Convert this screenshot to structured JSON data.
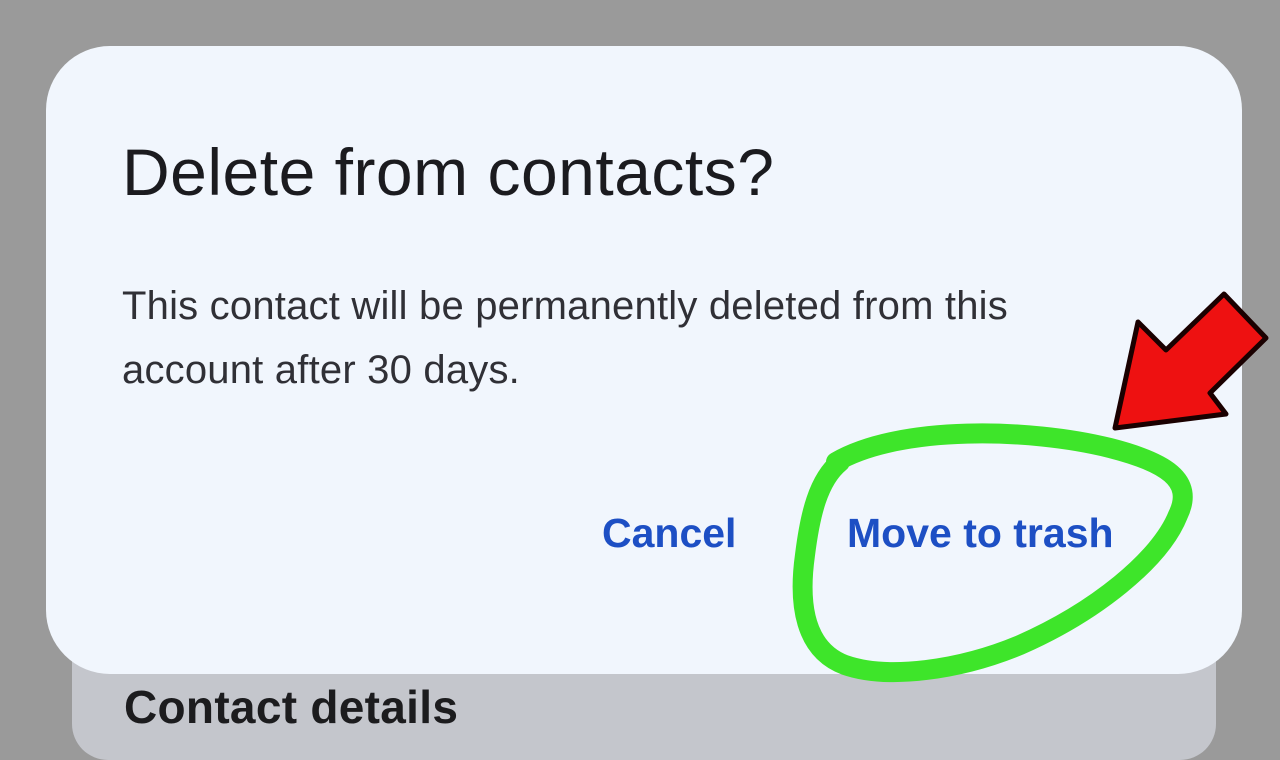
{
  "background": {
    "section_title": "Contact details"
  },
  "dialog": {
    "title": "Delete from contacts?",
    "message": "This contact will be permanently deleted from this account after 30 days.",
    "cancel_label": "Cancel",
    "confirm_label": "Move to trash"
  },
  "colors": {
    "dialog_background": "#f1f6fd",
    "button_text": "#1d4fc4",
    "highlight_circle": "#3ee52a",
    "arrow": "#ee1111"
  },
  "icons": {
    "arrow": "red-arrow-icon",
    "highlight": "green-circle-highlight"
  }
}
